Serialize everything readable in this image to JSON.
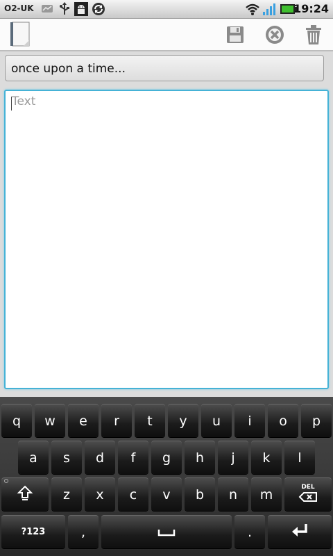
{
  "status_bar": {
    "carrier": "O2-UK",
    "time": "19:24",
    "icons": [
      "message-icon",
      "usb-icon",
      "android-debug-icon",
      "sync-icon",
      "wifi-icon",
      "signal-icon",
      "battery-icon"
    ],
    "battery_color": "#3fbf2f",
    "signal_color": "#3aa0e0"
  },
  "action_bar": {
    "icons": [
      "note-icon",
      "save-icon",
      "cancel-icon",
      "trash-icon"
    ]
  },
  "title_field": {
    "value": "once upon a time..."
  },
  "body_field": {
    "placeholder": "Text",
    "value": ""
  },
  "accent_color": "#45b2d6",
  "keyboard": {
    "row1": [
      "q",
      "w",
      "e",
      "r",
      "t",
      "y",
      "u",
      "i",
      "o",
      "p"
    ],
    "row2": [
      "a",
      "s",
      "d",
      "f",
      "g",
      "h",
      "j",
      "k",
      "l"
    ],
    "row3": [
      "z",
      "x",
      "c",
      "v",
      "b",
      "n",
      "m"
    ],
    "del_label": "DEL",
    "sym_label": "?123",
    "comma": ",",
    "period": "."
  }
}
